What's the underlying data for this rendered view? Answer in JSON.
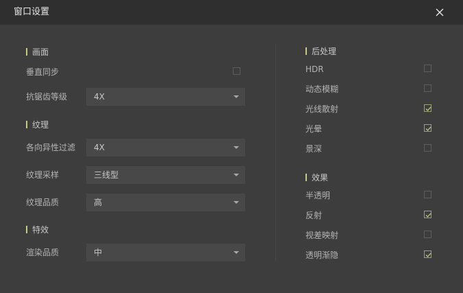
{
  "window": {
    "title": "窗口设置"
  },
  "left": {
    "section_display": "画面",
    "vsync_label": "垂直同步",
    "vsync_checked": false,
    "aa_label": "抗锯齿等级",
    "aa_value": "4X",
    "section_texture": "纹理",
    "aniso_label": "各向异性过滤",
    "aniso_value": "4X",
    "sampling_label": "纹理采样",
    "sampling_value": "三线型",
    "quality_label": "纹理品质",
    "quality_value": "高",
    "section_effects": "特效",
    "render_label": "渲染品质",
    "render_value": "中"
  },
  "right": {
    "section_post": "后处理",
    "post_items": [
      {
        "label": "HDR",
        "checked": false
      },
      {
        "label": "动态模糊",
        "checked": false
      },
      {
        "label": "光线散射",
        "checked": true
      },
      {
        "label": "光晕",
        "checked": true
      },
      {
        "label": "景深",
        "checked": false
      }
    ],
    "section_fx": "效果",
    "fx_items": [
      {
        "label": "半透明",
        "checked": false
      },
      {
        "label": "反射",
        "checked": true
      },
      {
        "label": "视差映射",
        "checked": false
      },
      {
        "label": "透明渐隐",
        "checked": true
      }
    ]
  },
  "icons": {
    "close": "close-icon",
    "check": "checkmark-icon",
    "dropdown": "caret-down-icon"
  },
  "colors": {
    "accent": "#c7cc80",
    "check": "#b6bb74",
    "titlebar": "#2f2f2f",
    "background": "#3d3d3d"
  }
}
